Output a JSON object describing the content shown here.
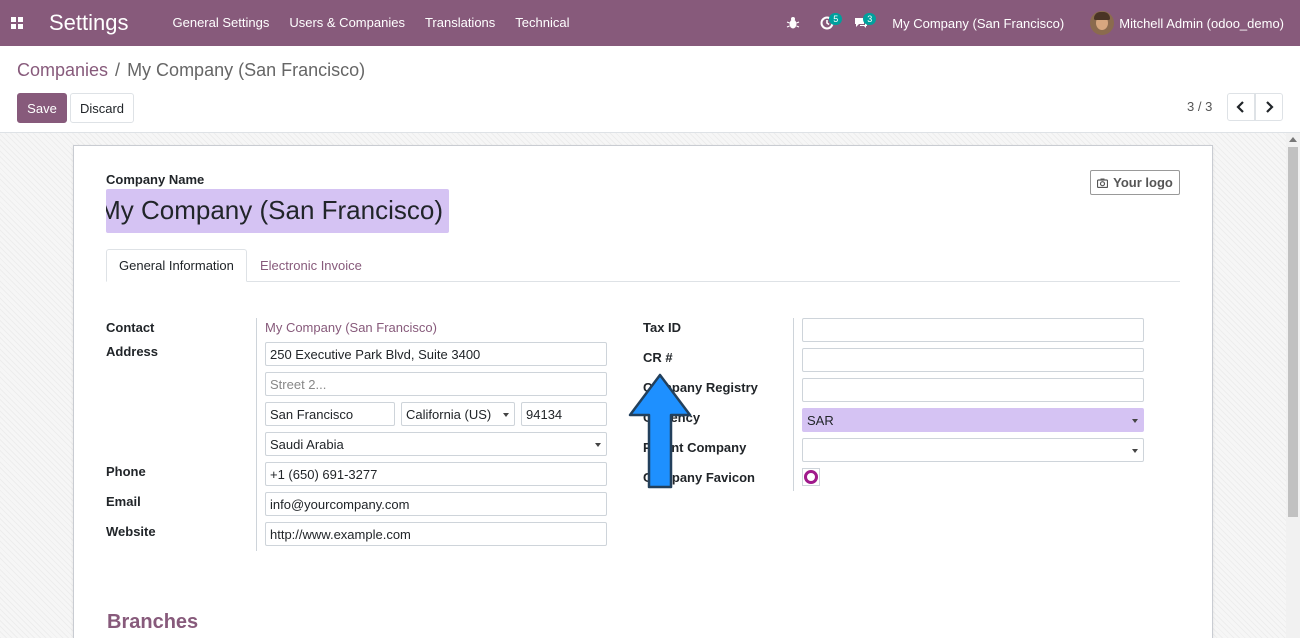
{
  "navbar": {
    "app_name": "Settings",
    "menu": [
      "General Settings",
      "Users & Companies",
      "Translations",
      "Technical"
    ],
    "activity_count": "5",
    "messages_count": "3",
    "company": "My Company (San Francisco)",
    "user": "Mitchell Admin (odoo_demo)"
  },
  "control_panel": {
    "breadcrumb_parent": "Companies",
    "breadcrumb_sep": "/",
    "breadcrumb_current": "My Company (San Francisco)",
    "save_label": "Save",
    "discard_label": "Discard",
    "pager": "3 / 3"
  },
  "form": {
    "company_name_label": "Company Name",
    "company_name": "My Company (San Francisco)",
    "logo_button": "Your logo",
    "tabs": [
      "General Information",
      "Electronic Invoice"
    ],
    "labels": {
      "contact": "Contact",
      "address": "Address",
      "phone": "Phone",
      "email": "Email",
      "website": "Website",
      "tax_id": "Tax ID",
      "cr": "CR #",
      "company_registry": "Company Registry",
      "currency": "Currency",
      "parent_company": "Parent Company",
      "company_favicon": "Company Favicon"
    },
    "contact": "My Company (San Francisco)",
    "street": "250 Executive Park Blvd, Suite 3400",
    "street2_placeholder": "Street 2...",
    "city": "San Francisco",
    "state": "California (US)",
    "zip": "94134",
    "country": "Saudi Arabia",
    "phone": "+1 (650) 691-3277",
    "email": "info@yourcompany.com",
    "website": "http://www.example.com",
    "tax_id": "",
    "cr": "",
    "company_registry": "",
    "currency": "SAR",
    "parent_company": "",
    "branches_title": "Branches"
  },
  "colors": {
    "brand": "#875a7b",
    "highlight": "#d5c3f3",
    "badge": "#00a09d",
    "arrow": "#1e90ff"
  }
}
